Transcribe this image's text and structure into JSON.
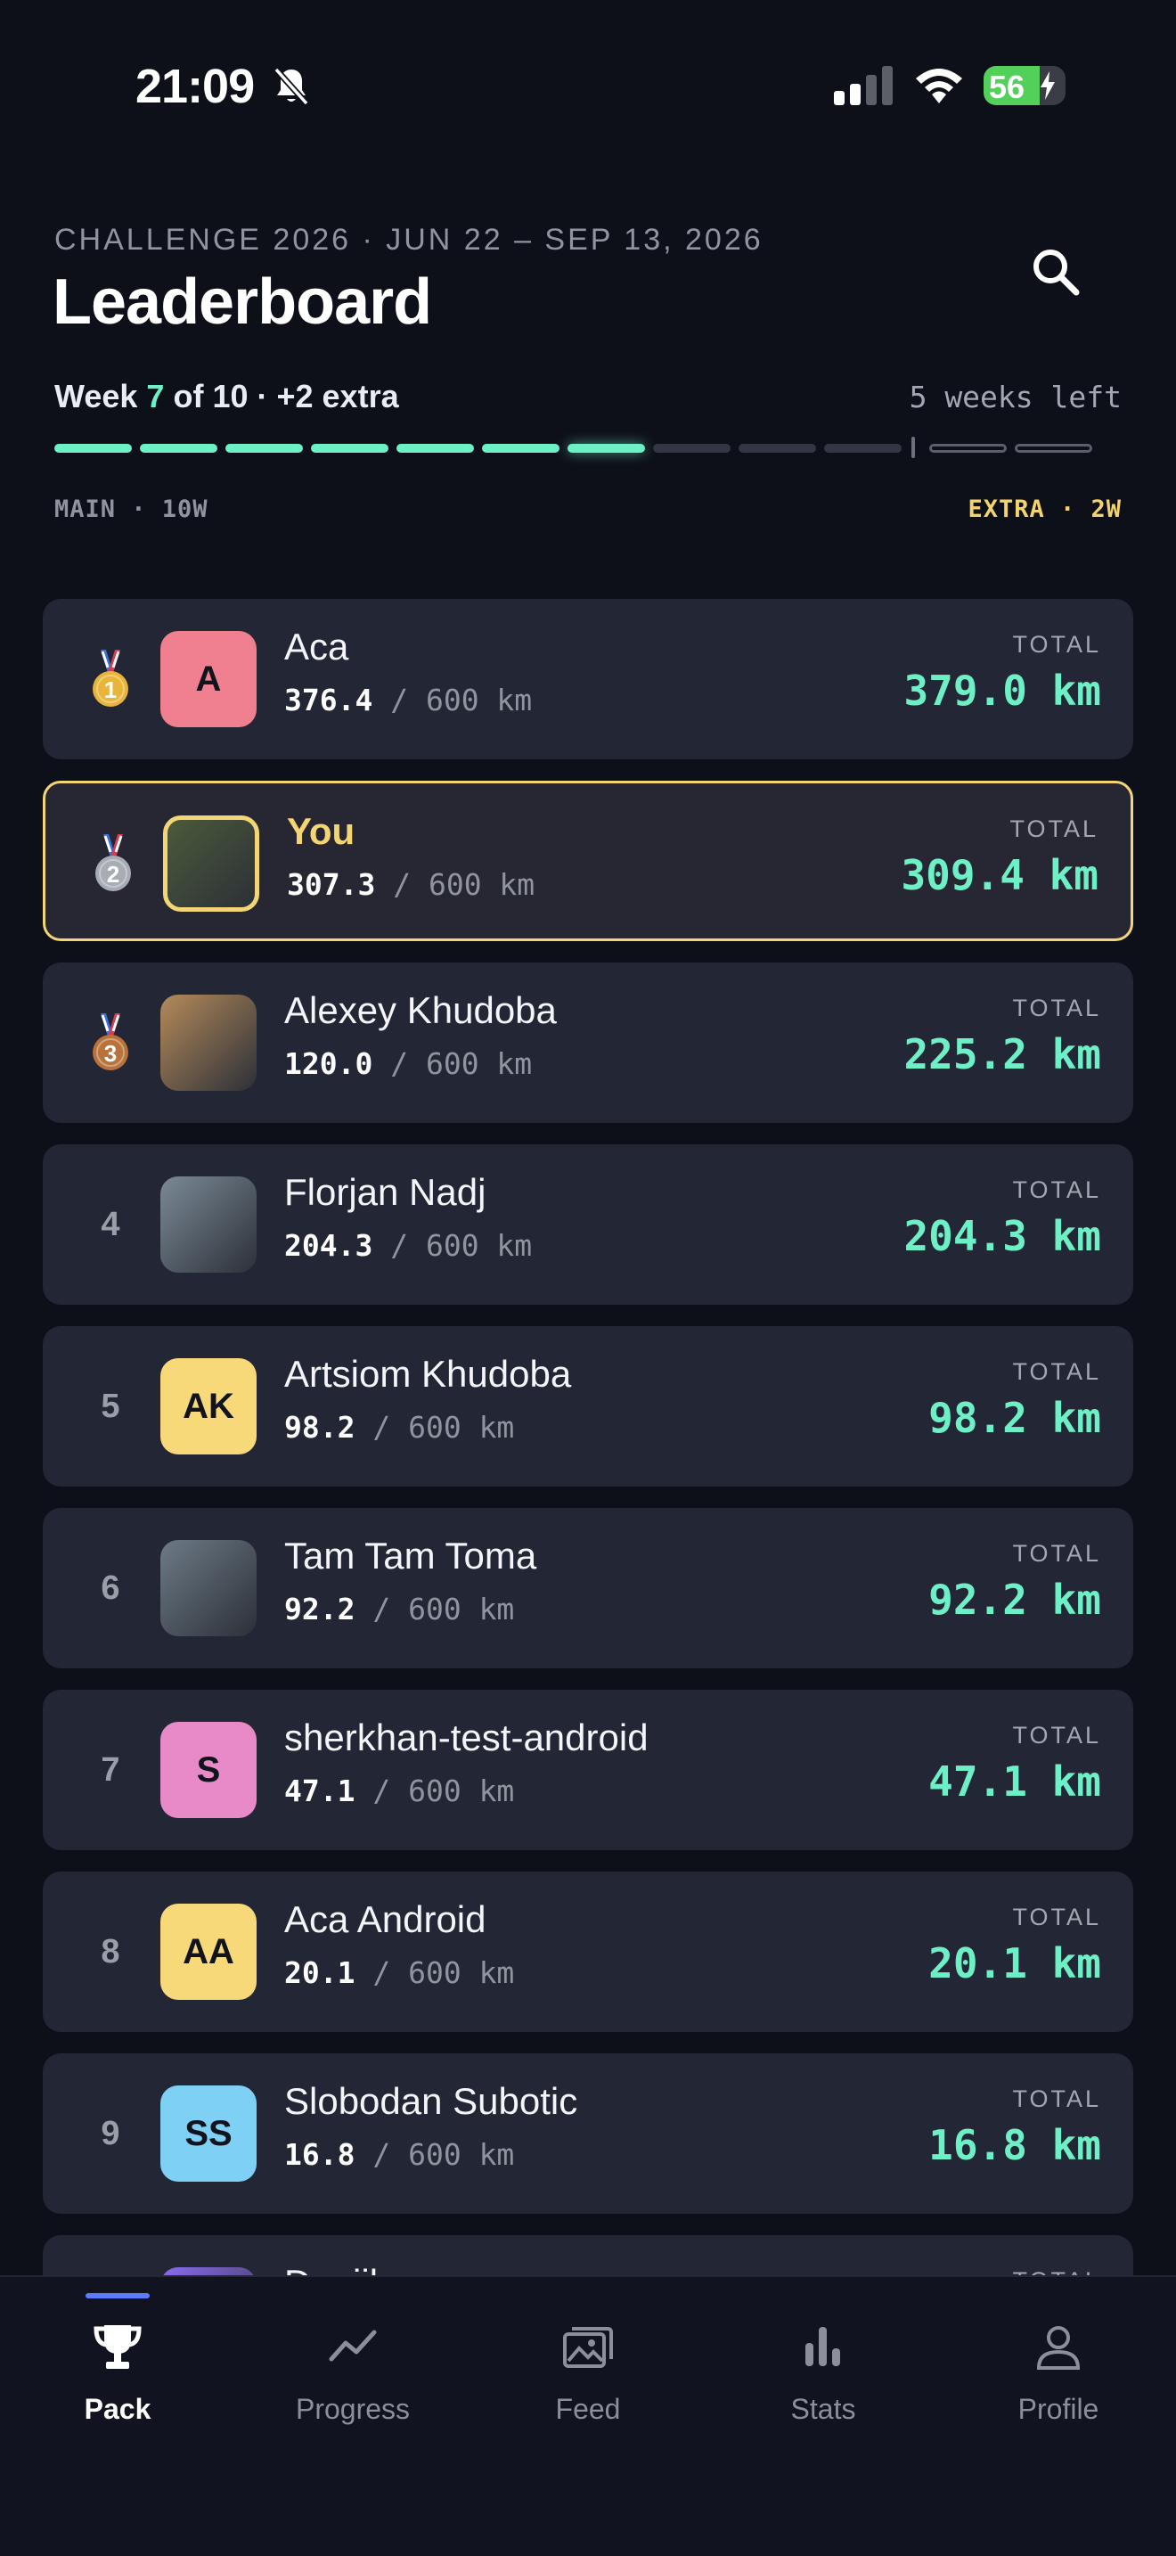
{
  "status_bar": {
    "time": "21:09",
    "battery": "56"
  },
  "header": {
    "challenge": "CHALLENGE 2026 · JUN 22 – SEP 13, 2026",
    "title": "Leaderboard",
    "week_prefix": "Week",
    "week_current": "7",
    "week_rest": "of 10 · +2 extra",
    "weeks_left": "5 weeks left",
    "main_label": "MAIN · 10W",
    "extra_label": "EXTRA · 2W"
  },
  "progress": {
    "main_weeks": 10,
    "extra_weeks": 2,
    "current_week": 7,
    "accent": "#6ef0c6"
  },
  "leaderboard": {
    "total_label": "TOTAL",
    "rows": [
      {
        "rank": "1",
        "medal": "gold-medal-icon",
        "name": "Aca",
        "initials": "A",
        "avatar_color": "#f07f90",
        "current": "376.4",
        "goal": "/ 600 km",
        "total": "379.0 km"
      },
      {
        "rank": "2",
        "medal": "silver-medal-icon",
        "name": "You",
        "initials": "",
        "avatar_color": "#4b5a3a",
        "current": "307.3",
        "goal": "/ 600 km",
        "total": "309.4 km",
        "highlight": true
      },
      {
        "rank": "3",
        "medal": "bronze-medal-icon",
        "name": "Alexey Khudoba",
        "initials": "",
        "avatar_color": "#b48a5a",
        "current": "120.0",
        "goal": "/ 600 km",
        "total": "225.2 km"
      },
      {
        "rank": "4",
        "name": "Florjan Nadj",
        "initials": "",
        "avatar_color": "#7b8a96",
        "current": "204.3",
        "goal": "/ 600 km",
        "total": "204.3 km"
      },
      {
        "rank": "5",
        "name": "Artsiom Khudoba",
        "initials": "AK",
        "avatar_color": "#f8d97a",
        "current": "98.2",
        "goal": "/ 600 km",
        "total": "98.2 km"
      },
      {
        "rank": "6",
        "name": "Tam Tam Toma",
        "initials": "",
        "avatar_color": "#6d7a86",
        "current": "92.2",
        "goal": "/ 600 km",
        "total": "92.2 km"
      },
      {
        "rank": "7",
        "name": "sherkhan-test-android",
        "initials": "S",
        "avatar_color": "#e98ac8",
        "current": "47.1",
        "goal": "/ 600 km",
        "total": "47.1 km"
      },
      {
        "rank": "8",
        "name": "Aca Android",
        "initials": "AA",
        "avatar_color": "#f8d97a",
        "current": "20.1",
        "goal": "/ 600 km",
        "total": "20.1 km"
      },
      {
        "rank": "9",
        "name": "Slobodan Subotic",
        "initials": "SS",
        "avatar_color": "#7fd0f5",
        "current": "16.8",
        "goal": "/ 600 km",
        "total": "16.8 km"
      },
      {
        "rank": "",
        "name": "Daniil",
        "initials": "",
        "avatar_color": "#8c6cf0",
        "current": "",
        "goal": "",
        "total": ""
      }
    ]
  },
  "tabbar": {
    "tabs": [
      {
        "label": "Pack",
        "icon": "trophy-icon",
        "active": true
      },
      {
        "label": "Progress",
        "icon": "trend-line-icon"
      },
      {
        "label": "Feed",
        "icon": "photos-icon"
      },
      {
        "label": "Stats",
        "icon": "bar-chart-icon"
      },
      {
        "label": "Profile",
        "icon": "person-icon"
      }
    ]
  }
}
